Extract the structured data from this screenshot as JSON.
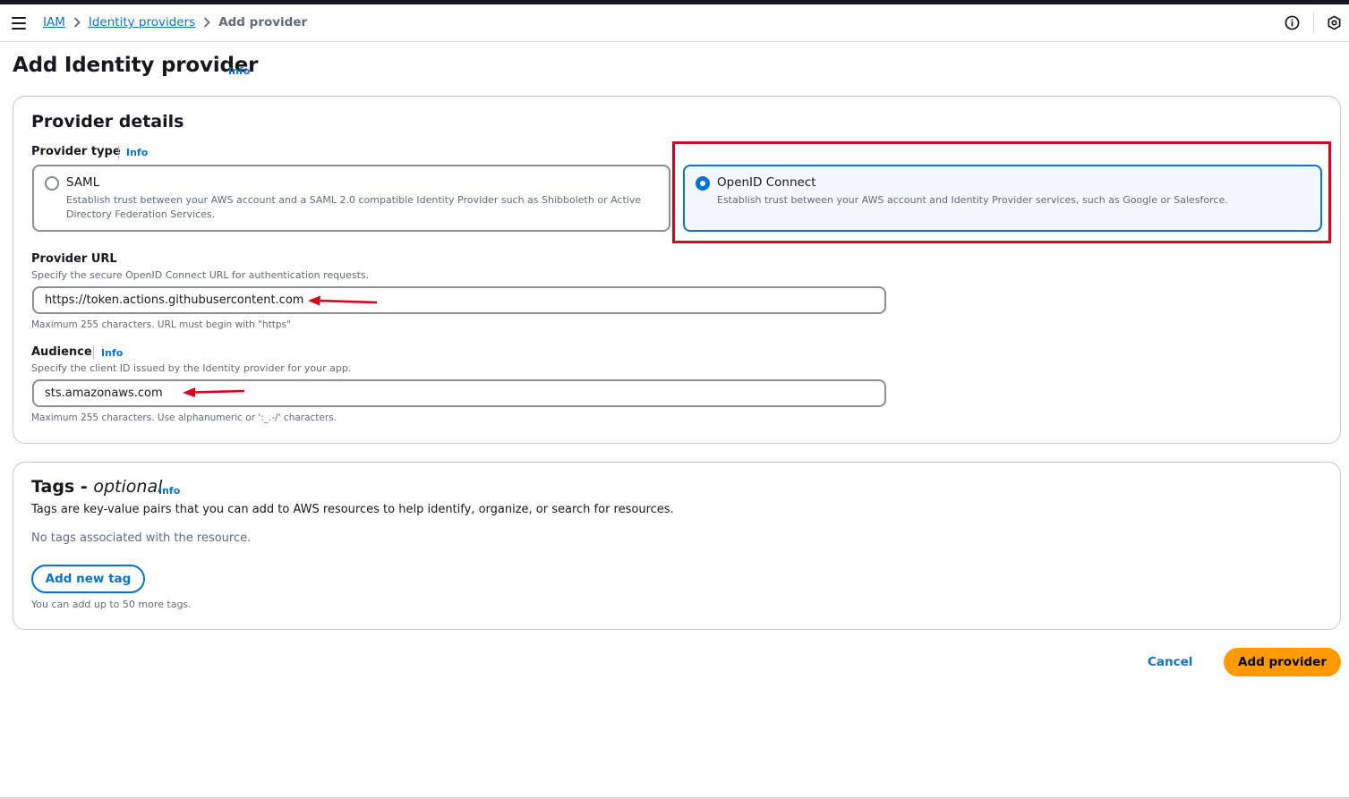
{
  "breadcrumb": {
    "items": [
      {
        "label": "IAM"
      },
      {
        "label": "Identity providers"
      },
      {
        "label": "Add provider"
      }
    ]
  },
  "page": {
    "title": "Add Identity provider",
    "info_label": "Info"
  },
  "provider_details": {
    "heading": "Provider details",
    "provider_type": {
      "label": "Provider type",
      "info_label": "Info",
      "options": [
        {
          "title": "SAML",
          "description": "Establish trust between your AWS account and a SAML 2.0 compatible Identity Provider such as Shibboleth or Active Directory Federation Services.",
          "selected": false
        },
        {
          "title": "OpenID Connect",
          "description": "Establish trust between your AWS account and Identity Provider services, such as Google or Salesforce.",
          "selected": true
        }
      ]
    },
    "provider_url": {
      "label": "Provider URL",
      "description": "Specify the secure OpenID Connect URL for authentication requests.",
      "value": "https://token.actions.githubusercontent.com",
      "hint": "Maximum 255 characters. URL must begin with \"https\""
    },
    "audience": {
      "label": "Audience",
      "info_label": "Info",
      "description": "Specify the client ID issued by the Identity provider for your app.",
      "value": "sts.amazonaws.com",
      "hint": "Maximum 255 characters. Use alphanumeric or ':_.-/' characters."
    }
  },
  "tags": {
    "heading_main": "Tags - ",
    "heading_optional": "optional",
    "info_label": "Info",
    "description": "Tags are key-value pairs that you can add to AWS resources to help identify, organize, or search for resources.",
    "empty_text": "No tags associated with the resource.",
    "add_button_label": "Add new tag",
    "hint": "You can add up to 50 more tags."
  },
  "footer": {
    "cancel_label": "Cancel",
    "submit_label": "Add provider"
  },
  "colors": {
    "accent": "#0972d3",
    "primary_button": "#ff9900",
    "annotation": "#e0001b"
  },
  "icons": [
    "menu-icon",
    "chevron-right-icon",
    "info-circle-icon",
    "hexagon-settings-icon"
  ]
}
